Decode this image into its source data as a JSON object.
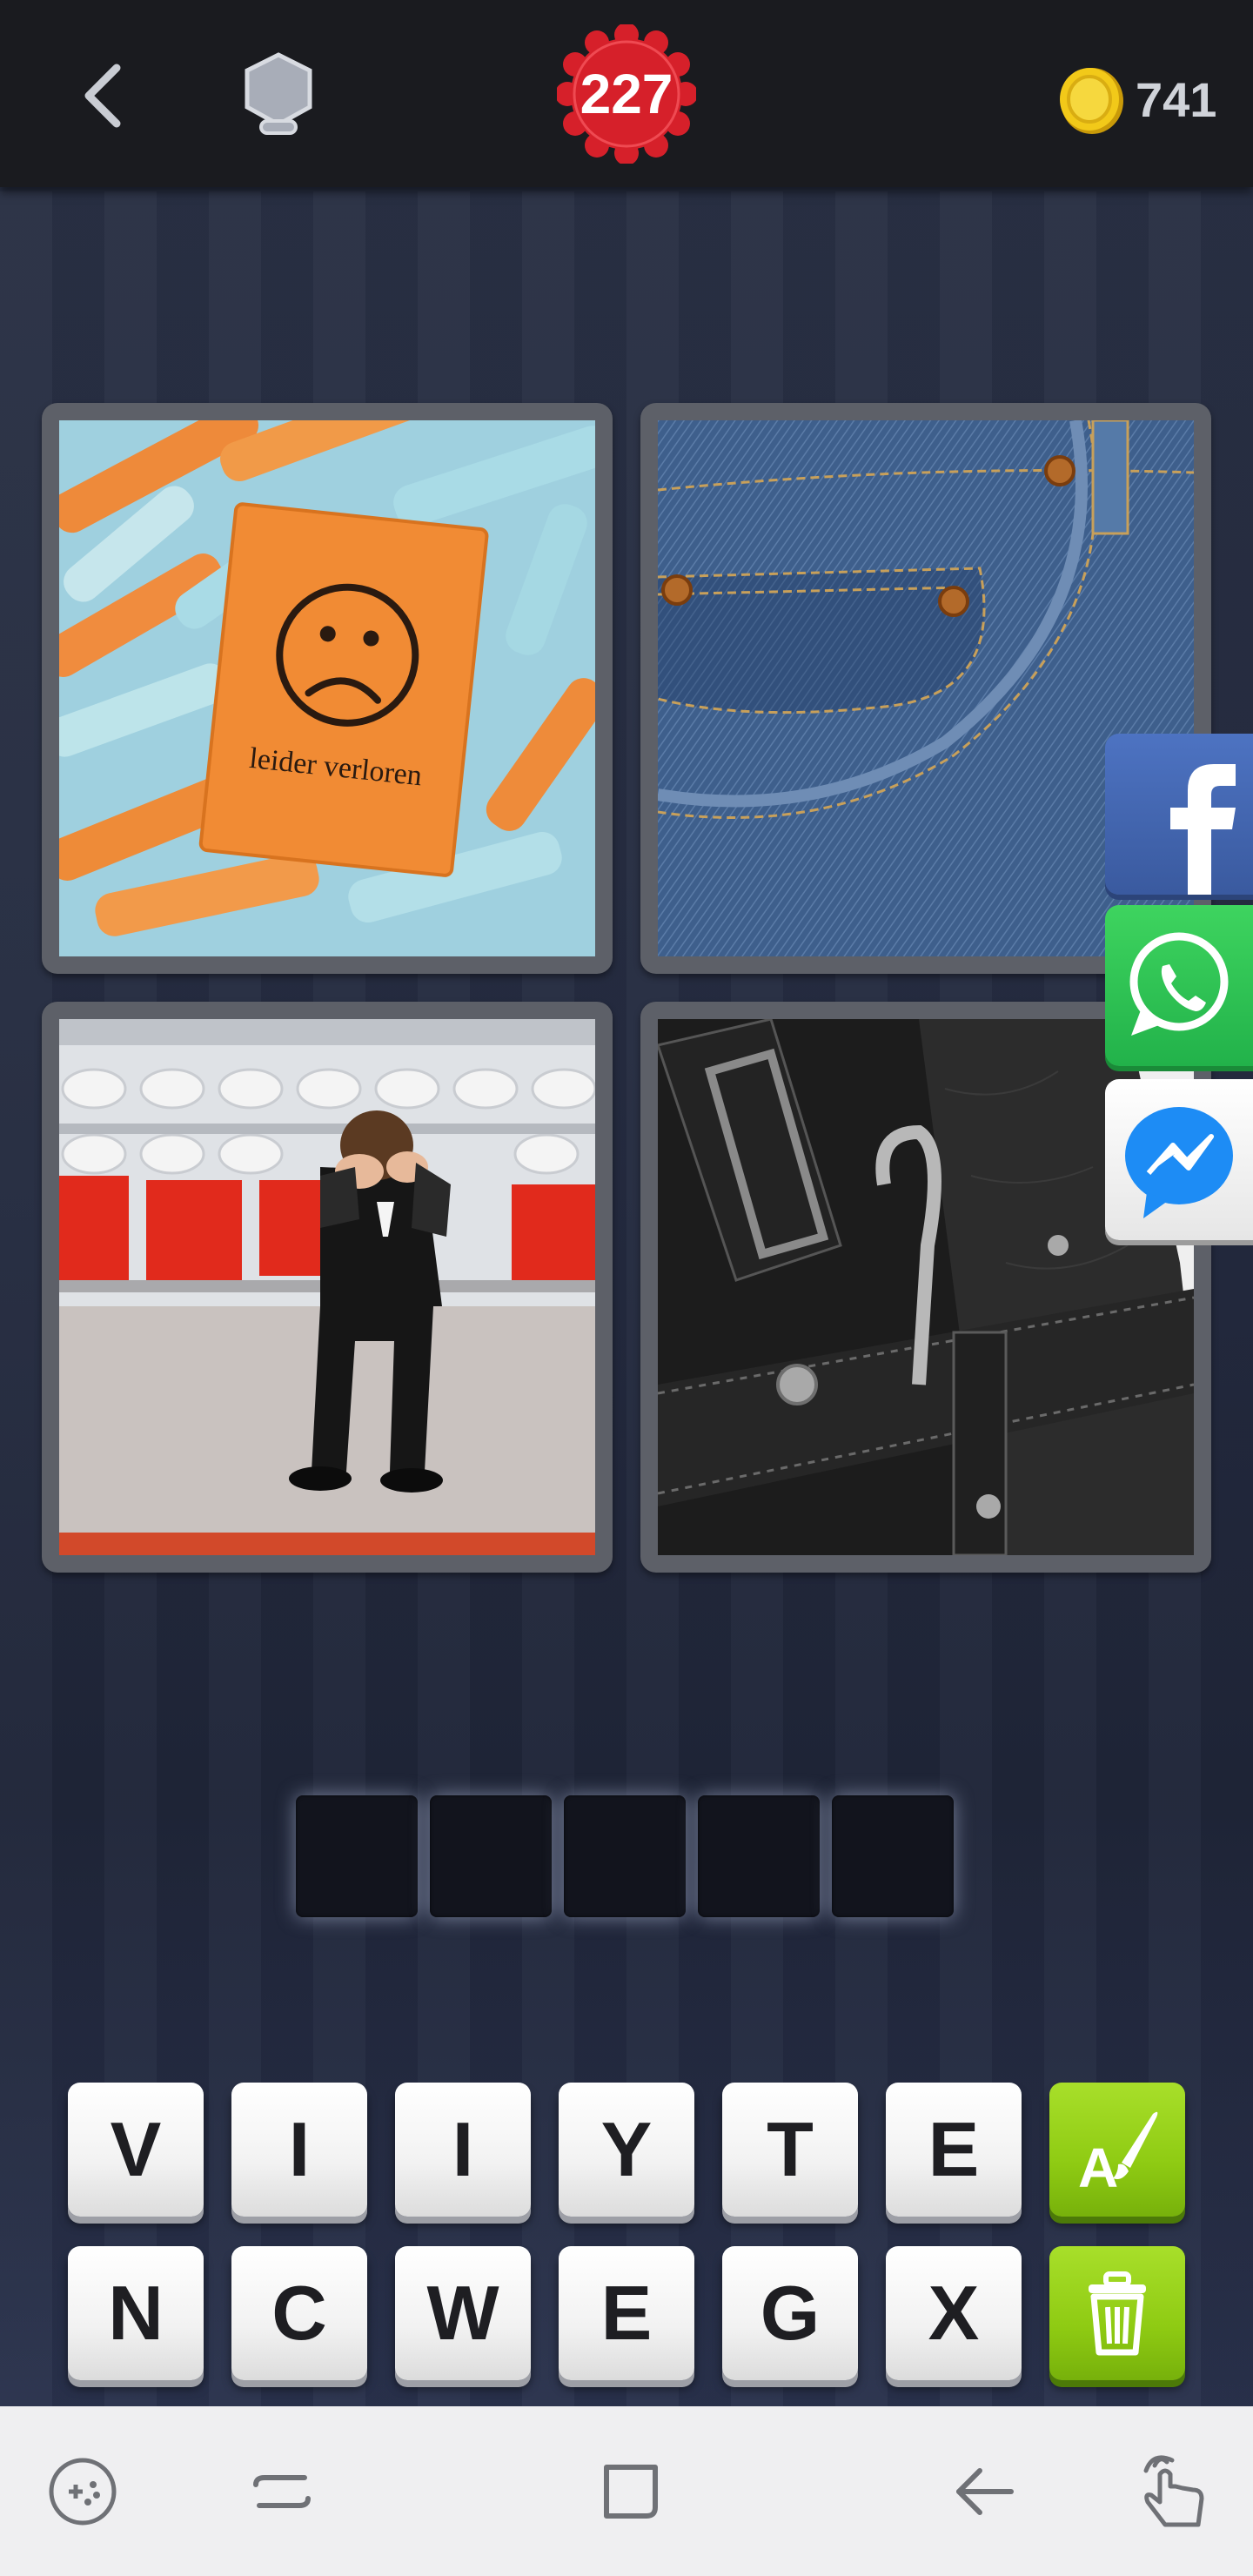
{
  "header": {
    "level": "227",
    "coins": "741"
  },
  "puzzle": {
    "photo1_text": "leider verloren",
    "answer_length": 5
  },
  "keyboard": {
    "row1": [
      "V",
      "I",
      "I",
      "Y",
      "T",
      "E"
    ],
    "row2": [
      "N",
      "C",
      "W",
      "E",
      "G",
      "X"
    ],
    "hint_reveal_icon": "brush-letter-icon",
    "remove_letters_icon": "trash-icon"
  },
  "social": [
    "facebook-icon",
    "whatsapp-icon",
    "messenger-icon"
  ],
  "colors": {
    "level_badge": "#d6202a",
    "green_key": "#8fcb13",
    "coin": "#f2c919"
  }
}
